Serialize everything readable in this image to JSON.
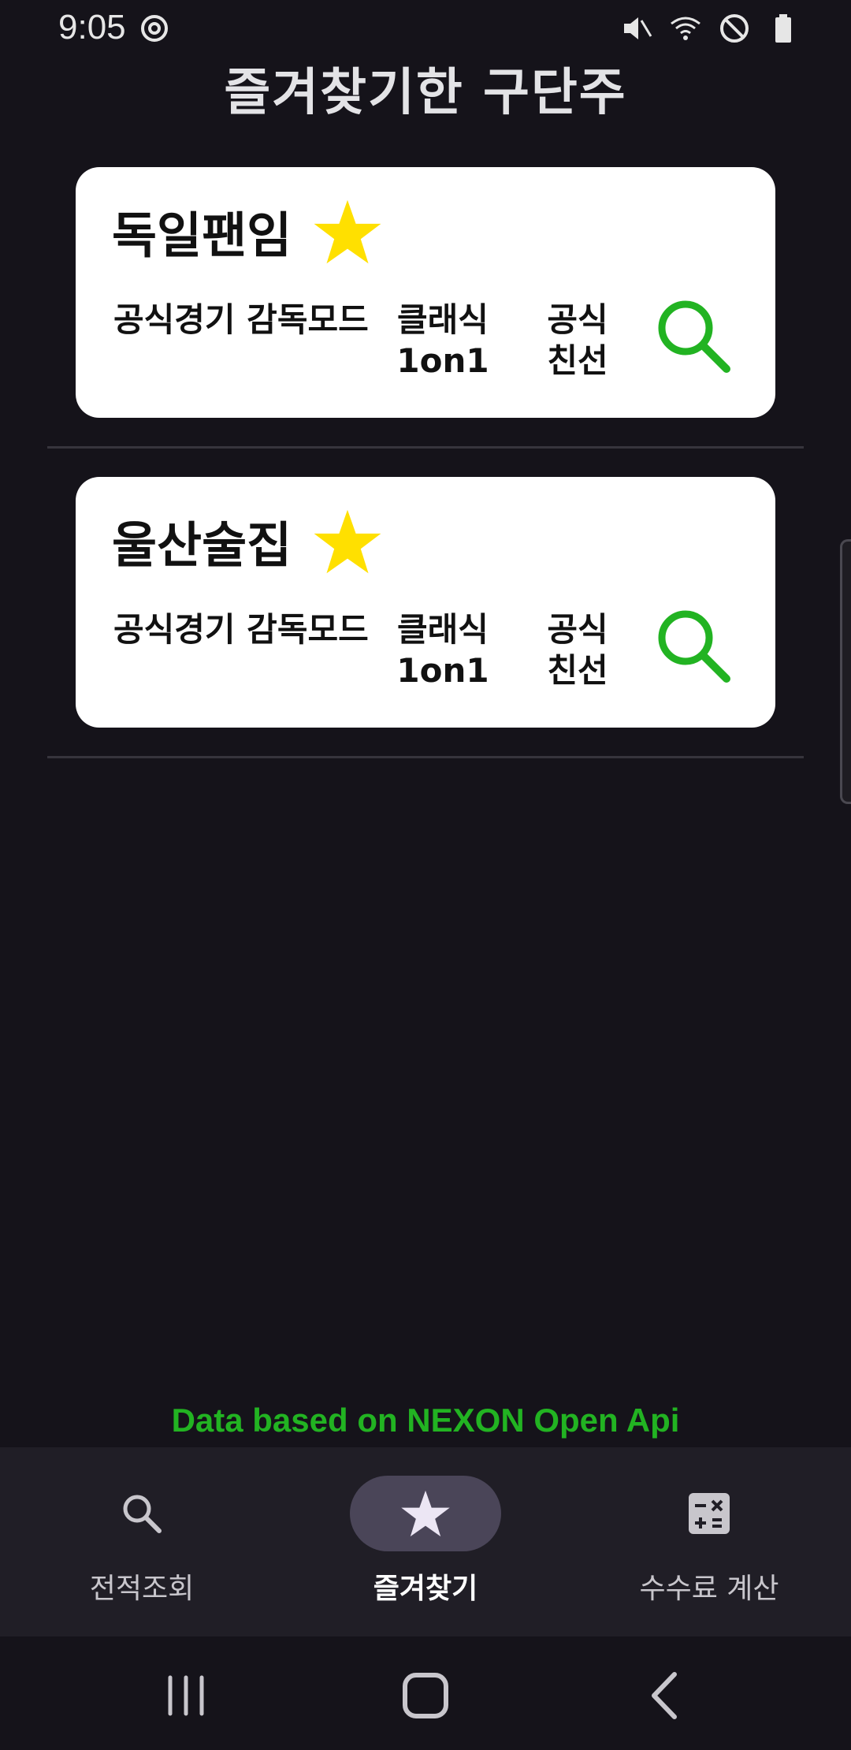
{
  "status_bar": {
    "time": "9:05",
    "icons": [
      "sync-icon",
      "mute-icon",
      "wifi-icon",
      "do-not-disturb-icon",
      "battery-icon"
    ]
  },
  "page": {
    "title": "즐겨찾기한 구단주"
  },
  "favorites": [
    {
      "name": "독일팬임",
      "starred": true,
      "options": [
        "공식경기 감독모드",
        "클래식\n1on1",
        "공식\n친선"
      ],
      "search_icon": "search-icon"
    },
    {
      "name": "울산술집",
      "starred": true,
      "options": [
        "공식경기 감독모드",
        "클래식\n1on1",
        "공식\n친선"
      ],
      "search_icon": "search-icon"
    }
  ],
  "credit": "Data based on NEXON Open Api",
  "bottom_nav": {
    "items": [
      {
        "label": "전적조회",
        "icon": "search-icon",
        "active": false
      },
      {
        "label": "즐겨찾기",
        "icon": "star-icon",
        "active": true
      },
      {
        "label": "수수료 계산",
        "icon": "calculator-icon",
        "active": false
      }
    ]
  },
  "colors": {
    "background": "#15131a",
    "card": "#ffffff",
    "star": "#ffe000",
    "accent_green": "#22b322",
    "nav_background": "#201e26",
    "nav_active_pill": "#4a4558"
  }
}
